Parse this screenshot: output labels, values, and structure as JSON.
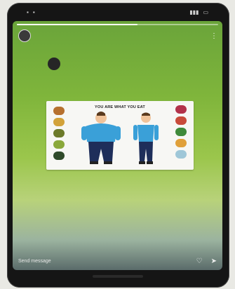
{
  "status_bar": {
    "time": "",
    "battery": ""
  },
  "story": {
    "username": "",
    "time": "",
    "progress": 0.6
  },
  "post": {
    "username": "",
    "time": ""
  },
  "card": {
    "title": "YOU ARE WHAT YOU EAT"
  },
  "bottom": {
    "send_placeholder": "Send message",
    "icons": [
      "heart-icon",
      "send-icon"
    ]
  },
  "colors": {
    "background_top": "#6aa43a",
    "background_mid": "#9bc64c",
    "card": "#f7f7f4"
  }
}
